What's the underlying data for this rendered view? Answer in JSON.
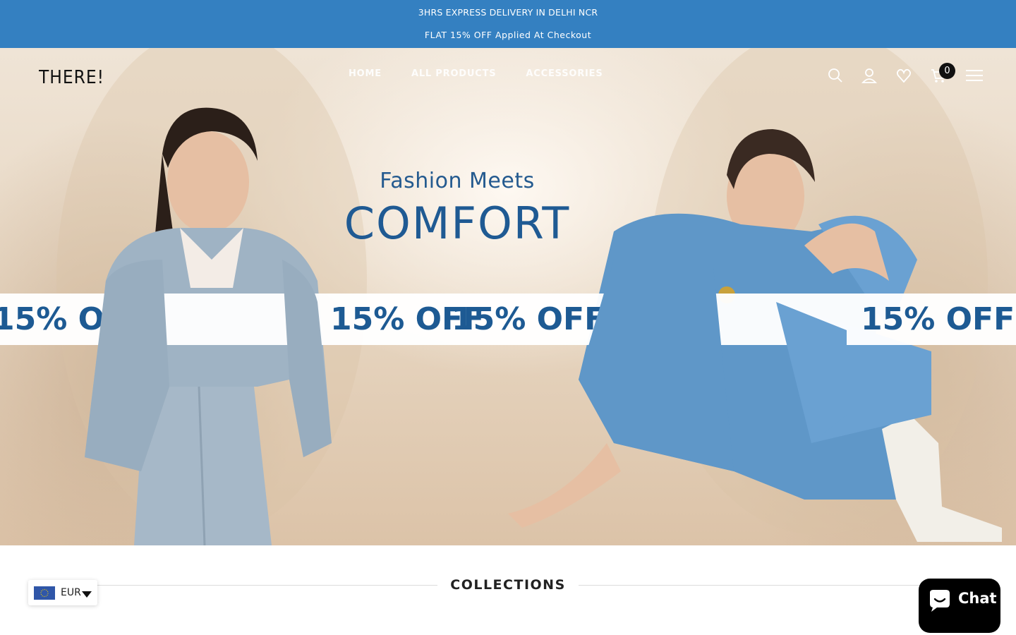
{
  "announcement": {
    "line1": "3HRS EXPRESS DELIVERY IN DELHI NCR",
    "line2": "FLAT 15% OFF Applied At Checkout"
  },
  "header": {
    "logo_text": "THERE!",
    "nav": [
      {
        "label": "HOME"
      },
      {
        "label": "ALL PRODUCTS"
      },
      {
        "label": "ACCESSORIES"
      }
    ],
    "cart_count": "0",
    "icons": [
      "search-icon",
      "account-icon",
      "wishlist-heart-icon",
      "cart-icon",
      "menu-hamburger-icon"
    ]
  },
  "hero": {
    "headline_small": "Fashion Meets",
    "headline_large": "COMFORT",
    "ribbon_text": "15% OFF",
    "ribbon_color": "#1d5a93"
  },
  "collections": {
    "title": "COLLECTIONS"
  },
  "currency": {
    "code": "EUR"
  },
  "chat": {
    "label": "Chat"
  },
  "colors": {
    "announcement_bg": "#3480c1",
    "accent_text": "#1f5a93",
    "chat_bg": "#000000"
  }
}
